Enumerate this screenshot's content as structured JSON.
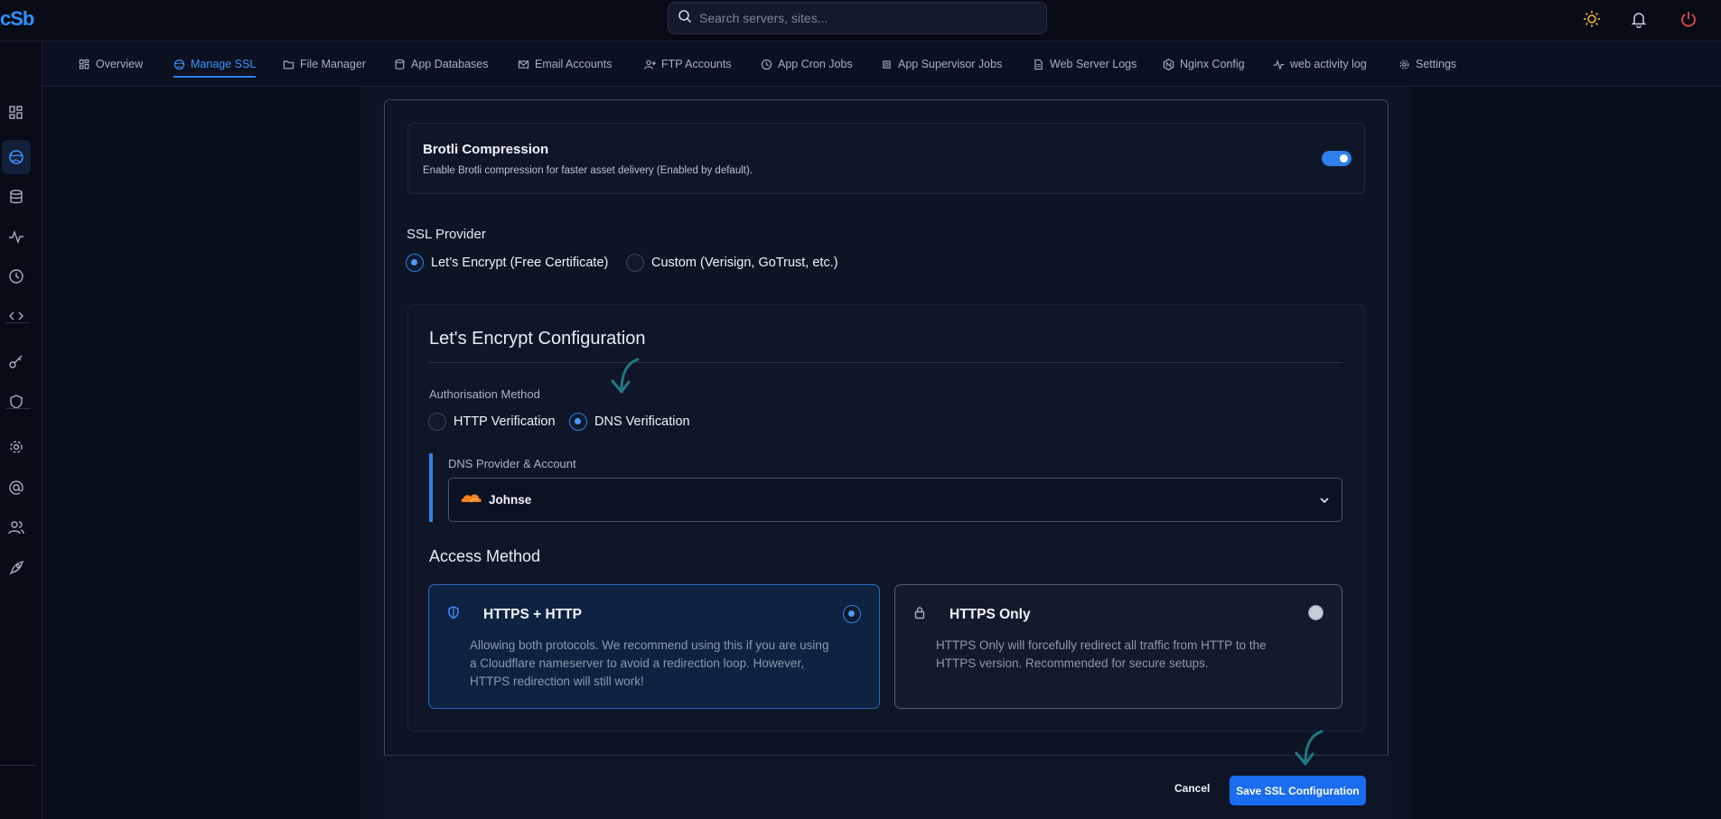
{
  "app": {
    "logo": "cSb"
  },
  "search": {
    "placeholder": "Search servers, sites..."
  },
  "tabs": [
    {
      "label": "Overview",
      "icon": "grid-icon"
    },
    {
      "label": "Manage SSL",
      "icon": "globe-icon",
      "active": true
    },
    {
      "label": "File Manager",
      "icon": "folder-icon"
    },
    {
      "label": "App Databases",
      "icon": "database-icon"
    },
    {
      "label": "Email Accounts",
      "icon": "mail-icon"
    },
    {
      "label": "FTP Accounts",
      "icon": "user-plus-icon"
    },
    {
      "label": "App Cron Jobs",
      "icon": "clock-cog-icon"
    },
    {
      "label": "App Supervisor Jobs",
      "icon": "cpu-icon"
    },
    {
      "label": "Web Server Logs",
      "icon": "file-icon"
    },
    {
      "label": "Nginx Config",
      "icon": "hexagon-icon"
    },
    {
      "label": "web activity log",
      "icon": "activity-icon"
    },
    {
      "label": "Settings",
      "icon": "gear-icon"
    }
  ],
  "brotli": {
    "title": "Brotli Compression",
    "description": "Enable Brotli compression for faster asset delivery (Enabled by default).",
    "enabled": true
  },
  "ssl_provider": {
    "label": "SSL Provider",
    "options": [
      {
        "label": "Let’s Encrypt (Free Certificate)",
        "selected": true
      },
      {
        "label": "Custom (Verisign, GoTrust, etc.)",
        "selected": false
      }
    ]
  },
  "letsencrypt": {
    "title": "Let's Encrypt Configuration",
    "auth_label": "Authorisation Method",
    "auth_options": [
      {
        "label": "HTTP Verification",
        "selected": false
      },
      {
        "label": "DNS Verification",
        "selected": true
      }
    ],
    "dns_label": "DNS Provider & Account",
    "dns_value": "Johnse",
    "access_title": "Access Method",
    "access_options": [
      {
        "title": "HTTPS + HTTP",
        "description": "Allowing both protocols. We recommend using this if you are using a Cloudflare nameserver to avoid a redirection loop. However, HTTPS redirection will still work!",
        "selected": true
      },
      {
        "title": "HTTPS Only",
        "description": "HTTPS Only will forcefully redirect all traffic from HTTP to the HTTPS version. Recommended for secure setups.",
        "selected": false
      }
    ]
  },
  "footer": {
    "cancel": "Cancel",
    "save": "Save SSL Configuration"
  },
  "colors": {
    "accent": "#2f80ed",
    "background": "#0a0f1c",
    "power": "#e5484d",
    "sun": "#f5b83d",
    "annotation": "#1f7a86"
  }
}
